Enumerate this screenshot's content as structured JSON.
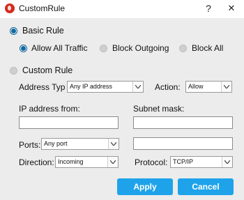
{
  "window": {
    "title": "CustomRule",
    "help_glyph": "?",
    "close_glyph": "✕",
    "icon": "app-logo-icon"
  },
  "basic_rule": {
    "label": "Basic Rule",
    "selected": true,
    "options": [
      {
        "label": "Allow All Traffic",
        "selected": true
      },
      {
        "label": "Block Outgoing",
        "selected": false
      },
      {
        "label": "Block All",
        "selected": false
      }
    ]
  },
  "custom_rule": {
    "label": "Custom Rule",
    "selected": false,
    "address_type_label": "Address Typ",
    "address_type_value": "Any IP address",
    "action_label": "Action:",
    "action_value": "Allow",
    "ip_from_label": "IP address from:",
    "ip_from_value": "",
    "subnet_label": "Subnet mask:",
    "subnet_value": "",
    "ports_label": "Ports:",
    "ports_value": "Any port",
    "ports_extra_value": "",
    "direction_label": "Direction:",
    "direction_value": "Incoming",
    "protocol_label": "Protocol:",
    "protocol_value": "TCP/IP"
  },
  "buttons": {
    "apply": "Apply",
    "cancel": "Cancel"
  },
  "colors": {
    "accent": "#1ea3ea",
    "radio_selected": "#0e6aa3",
    "panel_bg": "#ececec",
    "logo": "#d52b1e"
  }
}
